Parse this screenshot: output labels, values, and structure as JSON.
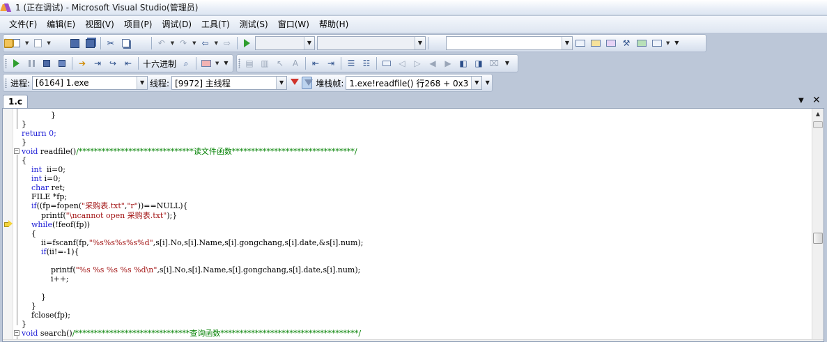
{
  "window": {
    "title": "1 (正在调试) - Microsoft Visual Studio(管理员)"
  },
  "menu": [
    "文件(F)",
    "编辑(E)",
    "视图(V)",
    "项目(P)",
    "调试(D)",
    "工具(T)",
    "测试(S)",
    "窗口(W)",
    "帮助(H)"
  ],
  "debug_toolbar": {
    "hex_label": "十六进制"
  },
  "location_bar": {
    "process_label": "进程:",
    "process_value": "[6164] 1.exe",
    "thread_label": "线程:",
    "thread_value": "[9972] 主线程",
    "stack_label": "堆栈帧:",
    "stack_value": "1.exe!readfile()  行268 + 0x3 字"
  },
  "tabs": [
    {
      "label": "1.c"
    }
  ],
  "code_lines": [
    "            }",
    "}",
    "return 0;",
    "}",
    "void readfile()/******************************读文件函数********************************/",
    "{",
    "    int  ii=0;",
    "    int i=0;",
    "    char ret;",
    "    FILE *fp;",
    "    if((fp=fopen(\"采购表.txt\",\"r\"))==NULL){",
    "        printf(\"\\ncannot open 采购表.txt\");}",
    "    while(!feof(fp))",
    "    {",
    "        ii=fscanf(fp,\"%s%s%s%s%d\",s[i].No,s[i].Name,s[i].gongchang,s[i].date,&s[i].num);",
    "        if(ii!=-1){",
    "",
    "            printf(\"%s %s %s %s %d\\n\",s[i].No,s[i].Name,s[i].gongchang,s[i].date,s[i].num);",
    "            i++;",
    "",
    "        }",
    "    }",
    "    fclose(fp);",
    "}",
    "void search()/******************************查询函数************************************/"
  ],
  "icons": {
    "current_statement": "yellow-arrow-icon",
    "filter": "filter-icon",
    "close": "close-icon"
  }
}
